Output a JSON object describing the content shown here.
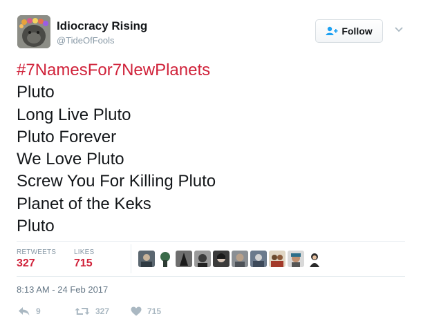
{
  "user": {
    "display_name": "Idiocracy Rising",
    "handle": "@TideOfFools",
    "avatar_icon": "flower-crown-gorilla-avatar"
  },
  "follow_button": {
    "label": "Follow",
    "icon": "add-user-icon"
  },
  "menu_caret_icon": "chevron-down-icon",
  "tweet": {
    "hashtag": "#7NamesFor7NewPlanets",
    "lines": [
      "Pluto",
      "Long Live Pluto",
      "Pluto Forever",
      "We Love Pluto",
      "Screw You For Killing Pluto",
      "Planet of the Keks",
      "Pluto"
    ]
  },
  "stats": {
    "retweets_label": "RETWEETS",
    "retweets_value": "327",
    "likes_label": "LIKES",
    "likes_value": "715"
  },
  "timestamp": "8:13 AM - 24 Feb 2017",
  "actions": {
    "reply_count": "9",
    "retweet_count": "327",
    "like_count": "715"
  },
  "colors": {
    "accent": "#d0223a",
    "muted": "#8899a6",
    "action": "#aab8c2"
  }
}
